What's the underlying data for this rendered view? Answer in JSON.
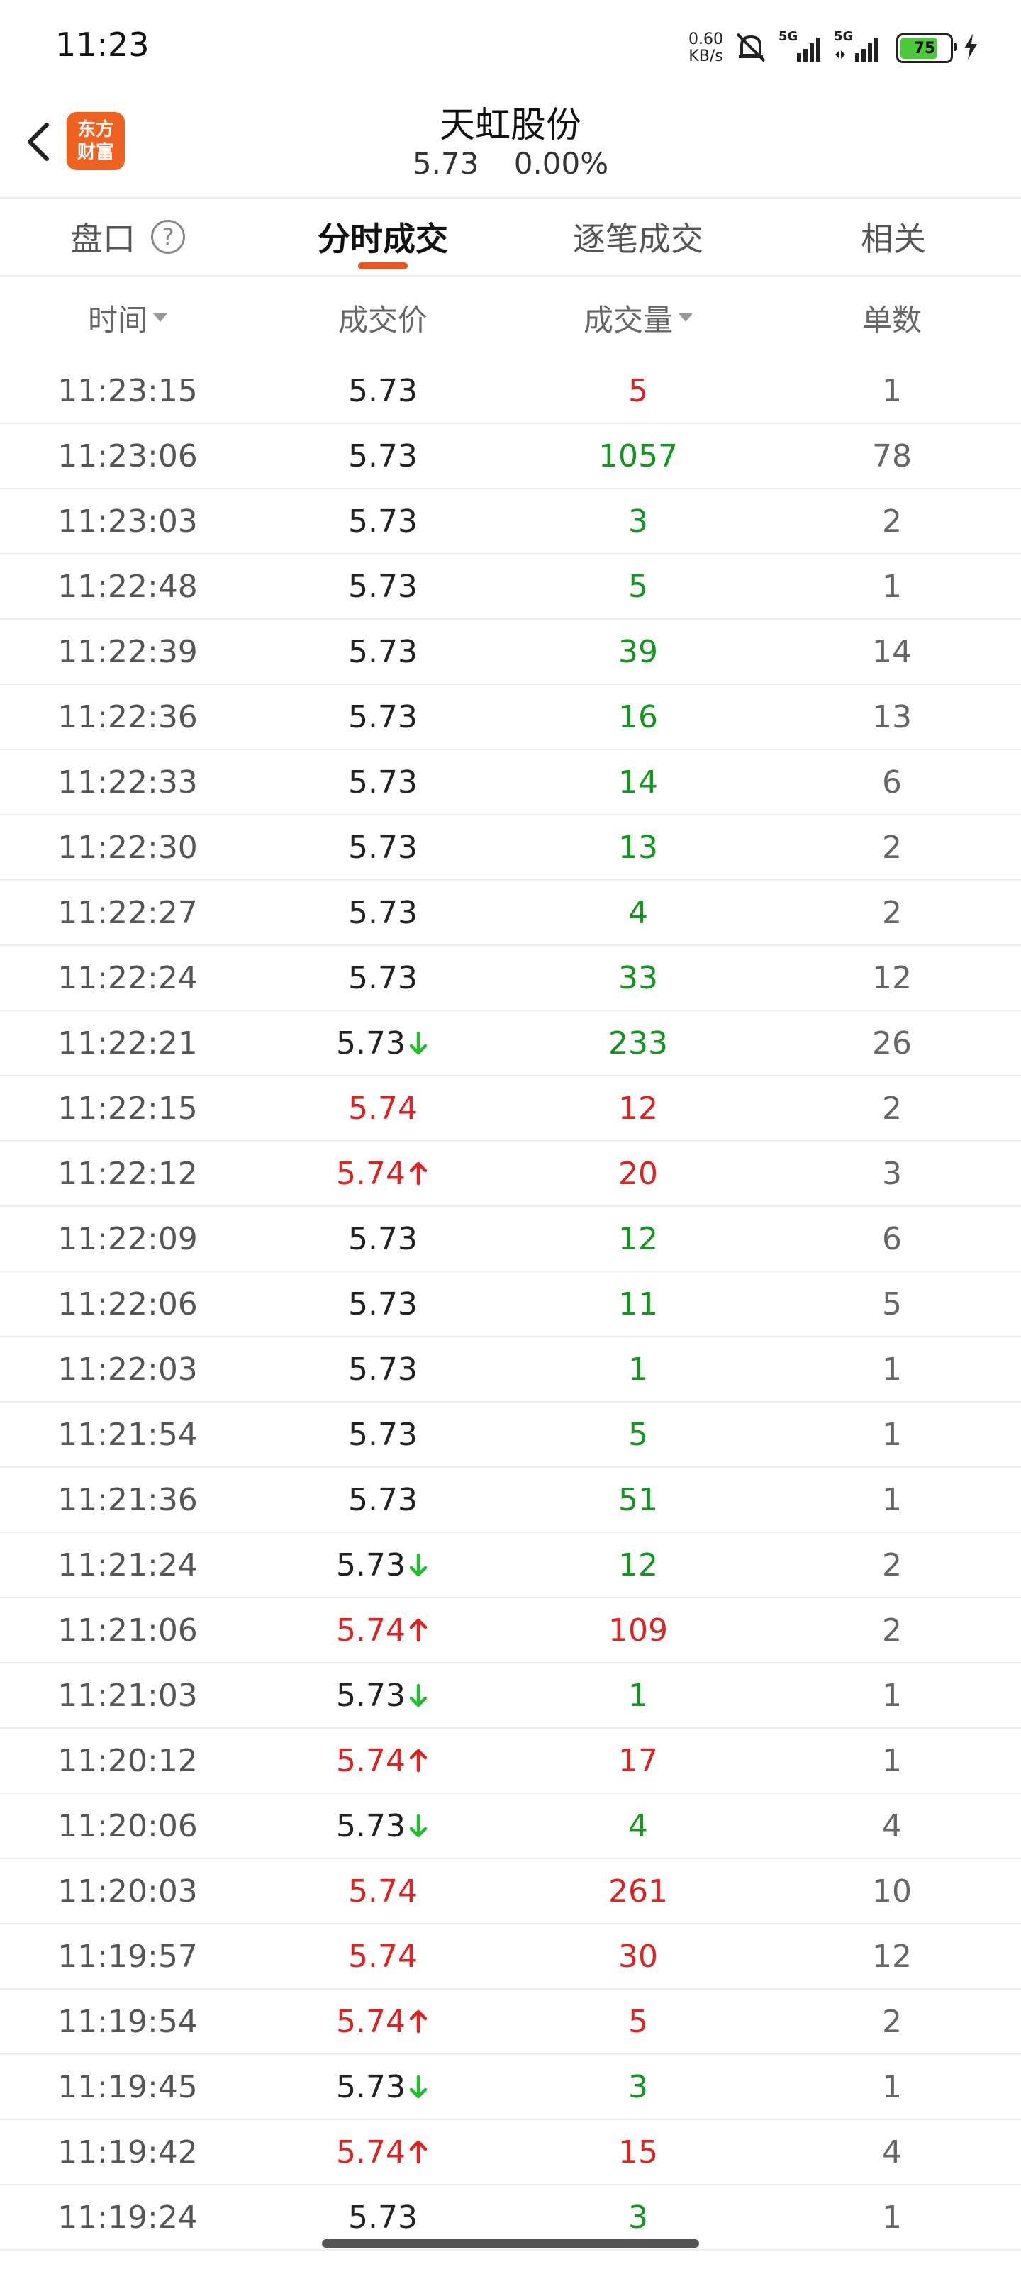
{
  "status_bar": {
    "time": "11:23",
    "speed_value": "0.60",
    "speed_unit": "KB/s",
    "signal1": "5G",
    "signal2": "5G",
    "battery": "75"
  },
  "header": {
    "logo_line1": "东方",
    "logo_line2": "财富",
    "title": "天虹股份",
    "price": "5.73",
    "change": "0.00%"
  },
  "tabs": [
    {
      "label": "盘口"
    },
    {
      "label": "分时成交"
    },
    {
      "label": "逐笔成交"
    },
    {
      "label": "相关"
    }
  ],
  "columns": {
    "time": "时间",
    "price": "成交价",
    "volume": "成交量",
    "count": "单数"
  },
  "colors": {
    "up": "#dd2222",
    "down": "#14951f",
    "neutral": "#222222",
    "accent": "#e8581f"
  },
  "trades": [
    {
      "time": "11:23:15",
      "price": "5.73",
      "price_color": "neutral",
      "arrow": "",
      "volume": "5",
      "volume_color": "up",
      "count": "1"
    },
    {
      "time": "11:23:06",
      "price": "5.73",
      "price_color": "neutral",
      "arrow": "",
      "volume": "1057",
      "volume_color": "down",
      "count": "78"
    },
    {
      "time": "11:23:03",
      "price": "5.73",
      "price_color": "neutral",
      "arrow": "",
      "volume": "3",
      "volume_color": "down",
      "count": "2"
    },
    {
      "time": "11:22:48",
      "price": "5.73",
      "price_color": "neutral",
      "arrow": "",
      "volume": "5",
      "volume_color": "down",
      "count": "1"
    },
    {
      "time": "11:22:39",
      "price": "5.73",
      "price_color": "neutral",
      "arrow": "",
      "volume": "39",
      "volume_color": "down",
      "count": "14"
    },
    {
      "time": "11:22:36",
      "price": "5.73",
      "price_color": "neutral",
      "arrow": "",
      "volume": "16",
      "volume_color": "down",
      "count": "13"
    },
    {
      "time": "11:22:33",
      "price": "5.73",
      "price_color": "neutral",
      "arrow": "",
      "volume": "14",
      "volume_color": "down",
      "count": "6"
    },
    {
      "time": "11:22:30",
      "price": "5.73",
      "price_color": "neutral",
      "arrow": "",
      "volume": "13",
      "volume_color": "down",
      "count": "2"
    },
    {
      "time": "11:22:27",
      "price": "5.73",
      "price_color": "neutral",
      "arrow": "",
      "volume": "4",
      "volume_color": "down",
      "count": "2"
    },
    {
      "time": "11:22:24",
      "price": "5.73",
      "price_color": "neutral",
      "arrow": "",
      "volume": "33",
      "volume_color": "down",
      "count": "12"
    },
    {
      "time": "11:22:21",
      "price": "5.73",
      "price_color": "neutral",
      "arrow": "down",
      "volume": "233",
      "volume_color": "down",
      "count": "26"
    },
    {
      "time": "11:22:15",
      "price": "5.74",
      "price_color": "up",
      "arrow": "",
      "volume": "12",
      "volume_color": "up",
      "count": "2"
    },
    {
      "time": "11:22:12",
      "price": "5.74",
      "price_color": "up",
      "arrow": "up",
      "volume": "20",
      "volume_color": "up",
      "count": "3"
    },
    {
      "time": "11:22:09",
      "price": "5.73",
      "price_color": "neutral",
      "arrow": "",
      "volume": "12",
      "volume_color": "down",
      "count": "6"
    },
    {
      "time": "11:22:06",
      "price": "5.73",
      "price_color": "neutral",
      "arrow": "",
      "volume": "11",
      "volume_color": "down",
      "count": "5"
    },
    {
      "time": "11:22:03",
      "price": "5.73",
      "price_color": "neutral",
      "arrow": "",
      "volume": "1",
      "volume_color": "down",
      "count": "1"
    },
    {
      "time": "11:21:54",
      "price": "5.73",
      "price_color": "neutral",
      "arrow": "",
      "volume": "5",
      "volume_color": "down",
      "count": "1"
    },
    {
      "time": "11:21:36",
      "price": "5.73",
      "price_color": "neutral",
      "arrow": "",
      "volume": "51",
      "volume_color": "down",
      "count": "1"
    },
    {
      "time": "11:21:24",
      "price": "5.73",
      "price_color": "neutral",
      "arrow": "down",
      "volume": "12",
      "volume_color": "down",
      "count": "2"
    },
    {
      "time": "11:21:06",
      "price": "5.74",
      "price_color": "up",
      "arrow": "up",
      "volume": "109",
      "volume_color": "up",
      "count": "2"
    },
    {
      "time": "11:21:03",
      "price": "5.73",
      "price_color": "neutral",
      "arrow": "down",
      "volume": "1",
      "volume_color": "down",
      "count": "1"
    },
    {
      "time": "11:20:12",
      "price": "5.74",
      "price_color": "up",
      "arrow": "up",
      "volume": "17",
      "volume_color": "up",
      "count": "1"
    },
    {
      "time": "11:20:06",
      "price": "5.73",
      "price_color": "neutral",
      "arrow": "down",
      "volume": "4",
      "volume_color": "down",
      "count": "4"
    },
    {
      "time": "11:20:03",
      "price": "5.74",
      "price_color": "up",
      "arrow": "",
      "volume": "261",
      "volume_color": "up",
      "count": "10"
    },
    {
      "time": "11:19:57",
      "price": "5.74",
      "price_color": "up",
      "arrow": "",
      "volume": "30",
      "volume_color": "up",
      "count": "12"
    },
    {
      "time": "11:19:54",
      "price": "5.74",
      "price_color": "up",
      "arrow": "up",
      "volume": "5",
      "volume_color": "up",
      "count": "2"
    },
    {
      "time": "11:19:45",
      "price": "5.73",
      "price_color": "neutral",
      "arrow": "down",
      "volume": "3",
      "volume_color": "down",
      "count": "1"
    },
    {
      "time": "11:19:42",
      "price": "5.74",
      "price_color": "up",
      "arrow": "up",
      "volume": "15",
      "volume_color": "up",
      "count": "4"
    },
    {
      "time": "11:19:24",
      "price": "5.73",
      "price_color": "neutral",
      "arrow": "",
      "volume": "3",
      "volume_color": "down",
      "count": "1"
    }
  ]
}
